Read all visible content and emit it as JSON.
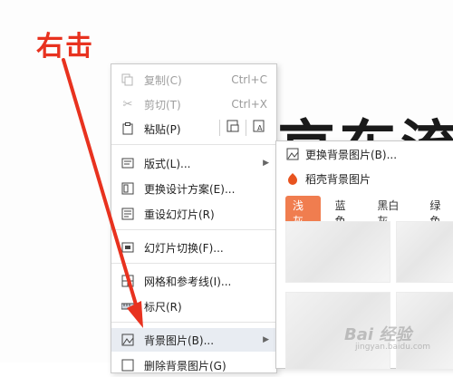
{
  "annotation": {
    "text": "右击"
  },
  "slide": {
    "title": "京东流"
  },
  "context_menu": {
    "copy": {
      "label": "复制(C)",
      "shortcut": "Ctrl+C"
    },
    "cut": {
      "label": "剪切(T)",
      "shortcut": "Ctrl+X"
    },
    "paste": {
      "label": "粘贴(P)"
    },
    "layout": {
      "label": "版式(L)..."
    },
    "change_design": {
      "label": "更换设计方案(E)..."
    },
    "reset_slide": {
      "label": "重设幻灯片(R)"
    },
    "transition": {
      "label": "幻灯片切换(F)..."
    },
    "grid": {
      "label": "网格和参考线(I)..."
    },
    "ruler": {
      "label": "标尺(R)"
    },
    "background_image": {
      "label": "背景图片(B)..."
    },
    "save_background": {
      "label": "删除背景图片(G)"
    }
  },
  "submenu": {
    "change_bg": {
      "label": "更换背景图片(B)..."
    },
    "docer_bg": {
      "label": "稻壳背景图片"
    },
    "tabs": [
      "浅灰",
      "蓝色",
      "黑白灰",
      "绿色"
    ],
    "active_tab": "浅灰"
  },
  "watermark": {
    "text": "Bai 经验",
    "sub": "jingyan.baidu.com"
  },
  "colors": {
    "annotation": "#e8321f",
    "active_tab": "#f07d4f",
    "docer_icon": "#e8531f"
  }
}
